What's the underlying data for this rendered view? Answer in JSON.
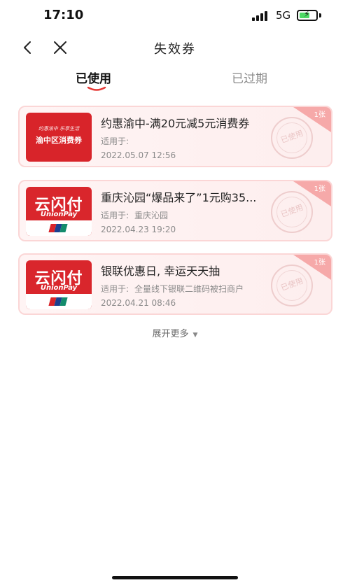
{
  "status_bar": {
    "time": "17:10",
    "network": "5G"
  },
  "nav": {
    "title": "失效券"
  },
  "tabs": [
    {
      "label": "已使用",
      "active": true
    },
    {
      "label": "已过期",
      "active": false
    }
  ],
  "coupons": [
    {
      "title": "约惠渝中-满20元减5元消费券",
      "scope_label": "适用于:",
      "scope_value": "",
      "date": "2022.05.07 12:56",
      "count": "1张",
      "stamp": "已使用",
      "thumb_line1": "约惠渝中 乐享生活",
      "thumb_line2": "渝中区消费券"
    },
    {
      "title": "重庆沁园“爆品来了”1元购35...",
      "scope_label": "适用于:",
      "scope_value": "重庆沁园",
      "date": "2022.04.23 19:20",
      "count": "1张",
      "stamp": "已使用",
      "thumb_cn": "云闪付",
      "thumb_en": "UnionPay"
    },
    {
      "title": "银联优惠日, 幸运天天抽",
      "scope_label": "适用于:",
      "scope_value": "全量线下银联二维码被扫商户",
      "date": "2022.04.21 08:46",
      "count": "1张",
      "stamp": "已使用",
      "thumb_cn": "云闪付",
      "thumb_en": "UnionPay"
    }
  ],
  "expand_label": "展开更多",
  "colors": {
    "accent": "#e53935",
    "card_border": "#fbd6d6",
    "card_bg": "#fff4f4",
    "corner": "#f6a9a9"
  },
  "icons": {
    "back": "chevron-left-icon",
    "close": "close-icon",
    "expand": "triangle-down-icon"
  }
}
